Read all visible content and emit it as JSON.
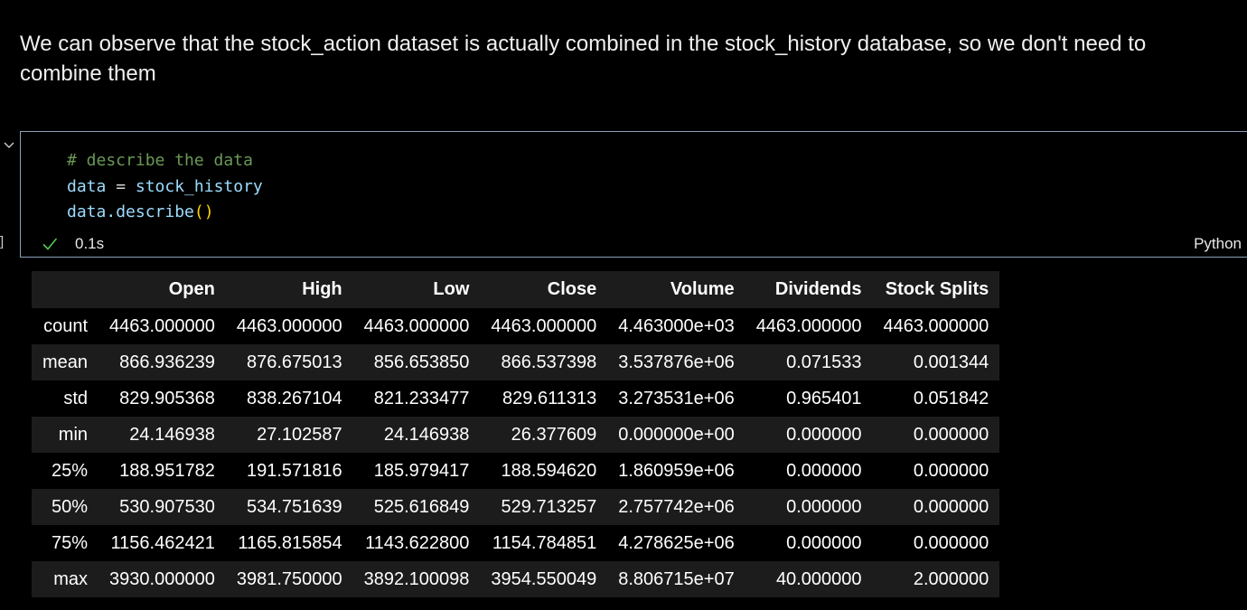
{
  "markdown": {
    "text": "We can observe that the stock_action dataset is actually combined in the stock_history database, so we don't need to combine them"
  },
  "cell": {
    "exec_bracket": "]",
    "code": {
      "line1_comment": "# describe the data",
      "line2_var": "data",
      "line2_op": " = ",
      "line2_value": "stock_history",
      "line3_obj": "data",
      "line3_method": ".describe",
      "line3_parens": "()"
    },
    "status": {
      "icon": "check-icon",
      "time": "0.1s"
    },
    "language": "Python",
    "colors": {
      "border": "#8aa0b8",
      "comment": "#6a9955",
      "variable": "#9cdcfe",
      "paren": "#ffd700",
      "check": "#4ec94e"
    }
  },
  "output": {
    "columns": [
      "Open",
      "High",
      "Low",
      "Close",
      "Volume",
      "Dividends",
      "Stock Splits"
    ],
    "rows": [
      {
        "label": "count",
        "values": [
          "4463.000000",
          "4463.000000",
          "4463.000000",
          "4463.000000",
          "4.463000e+03",
          "4463.000000",
          "4463.000000"
        ]
      },
      {
        "label": "mean",
        "values": [
          "866.936239",
          "876.675013",
          "856.653850",
          "866.537398",
          "3.537876e+06",
          "0.071533",
          "0.001344"
        ]
      },
      {
        "label": "std",
        "values": [
          "829.905368",
          "838.267104",
          "821.233477",
          "829.611313",
          "3.273531e+06",
          "0.965401",
          "0.051842"
        ]
      },
      {
        "label": "min",
        "values": [
          "24.146938",
          "27.102587",
          "24.146938",
          "26.377609",
          "0.000000e+00",
          "0.000000",
          "0.000000"
        ]
      },
      {
        "label": "25%",
        "values": [
          "188.951782",
          "191.571816",
          "185.979417",
          "188.594620",
          "1.860959e+06",
          "0.000000",
          "0.000000"
        ]
      },
      {
        "label": "50%",
        "values": [
          "530.907530",
          "534.751639",
          "525.616849",
          "529.713257",
          "2.757742e+06",
          "0.000000",
          "0.000000"
        ]
      },
      {
        "label": "75%",
        "values": [
          "1156.462421",
          "1165.815854",
          "1143.622800",
          "1154.784851",
          "4.278625e+06",
          "0.000000",
          "0.000000"
        ]
      },
      {
        "label": "max",
        "values": [
          "3930.000000",
          "3981.750000",
          "3892.100098",
          "3954.550049",
          "8.806715e+07",
          "40.000000",
          "2.000000"
        ]
      }
    ]
  }
}
